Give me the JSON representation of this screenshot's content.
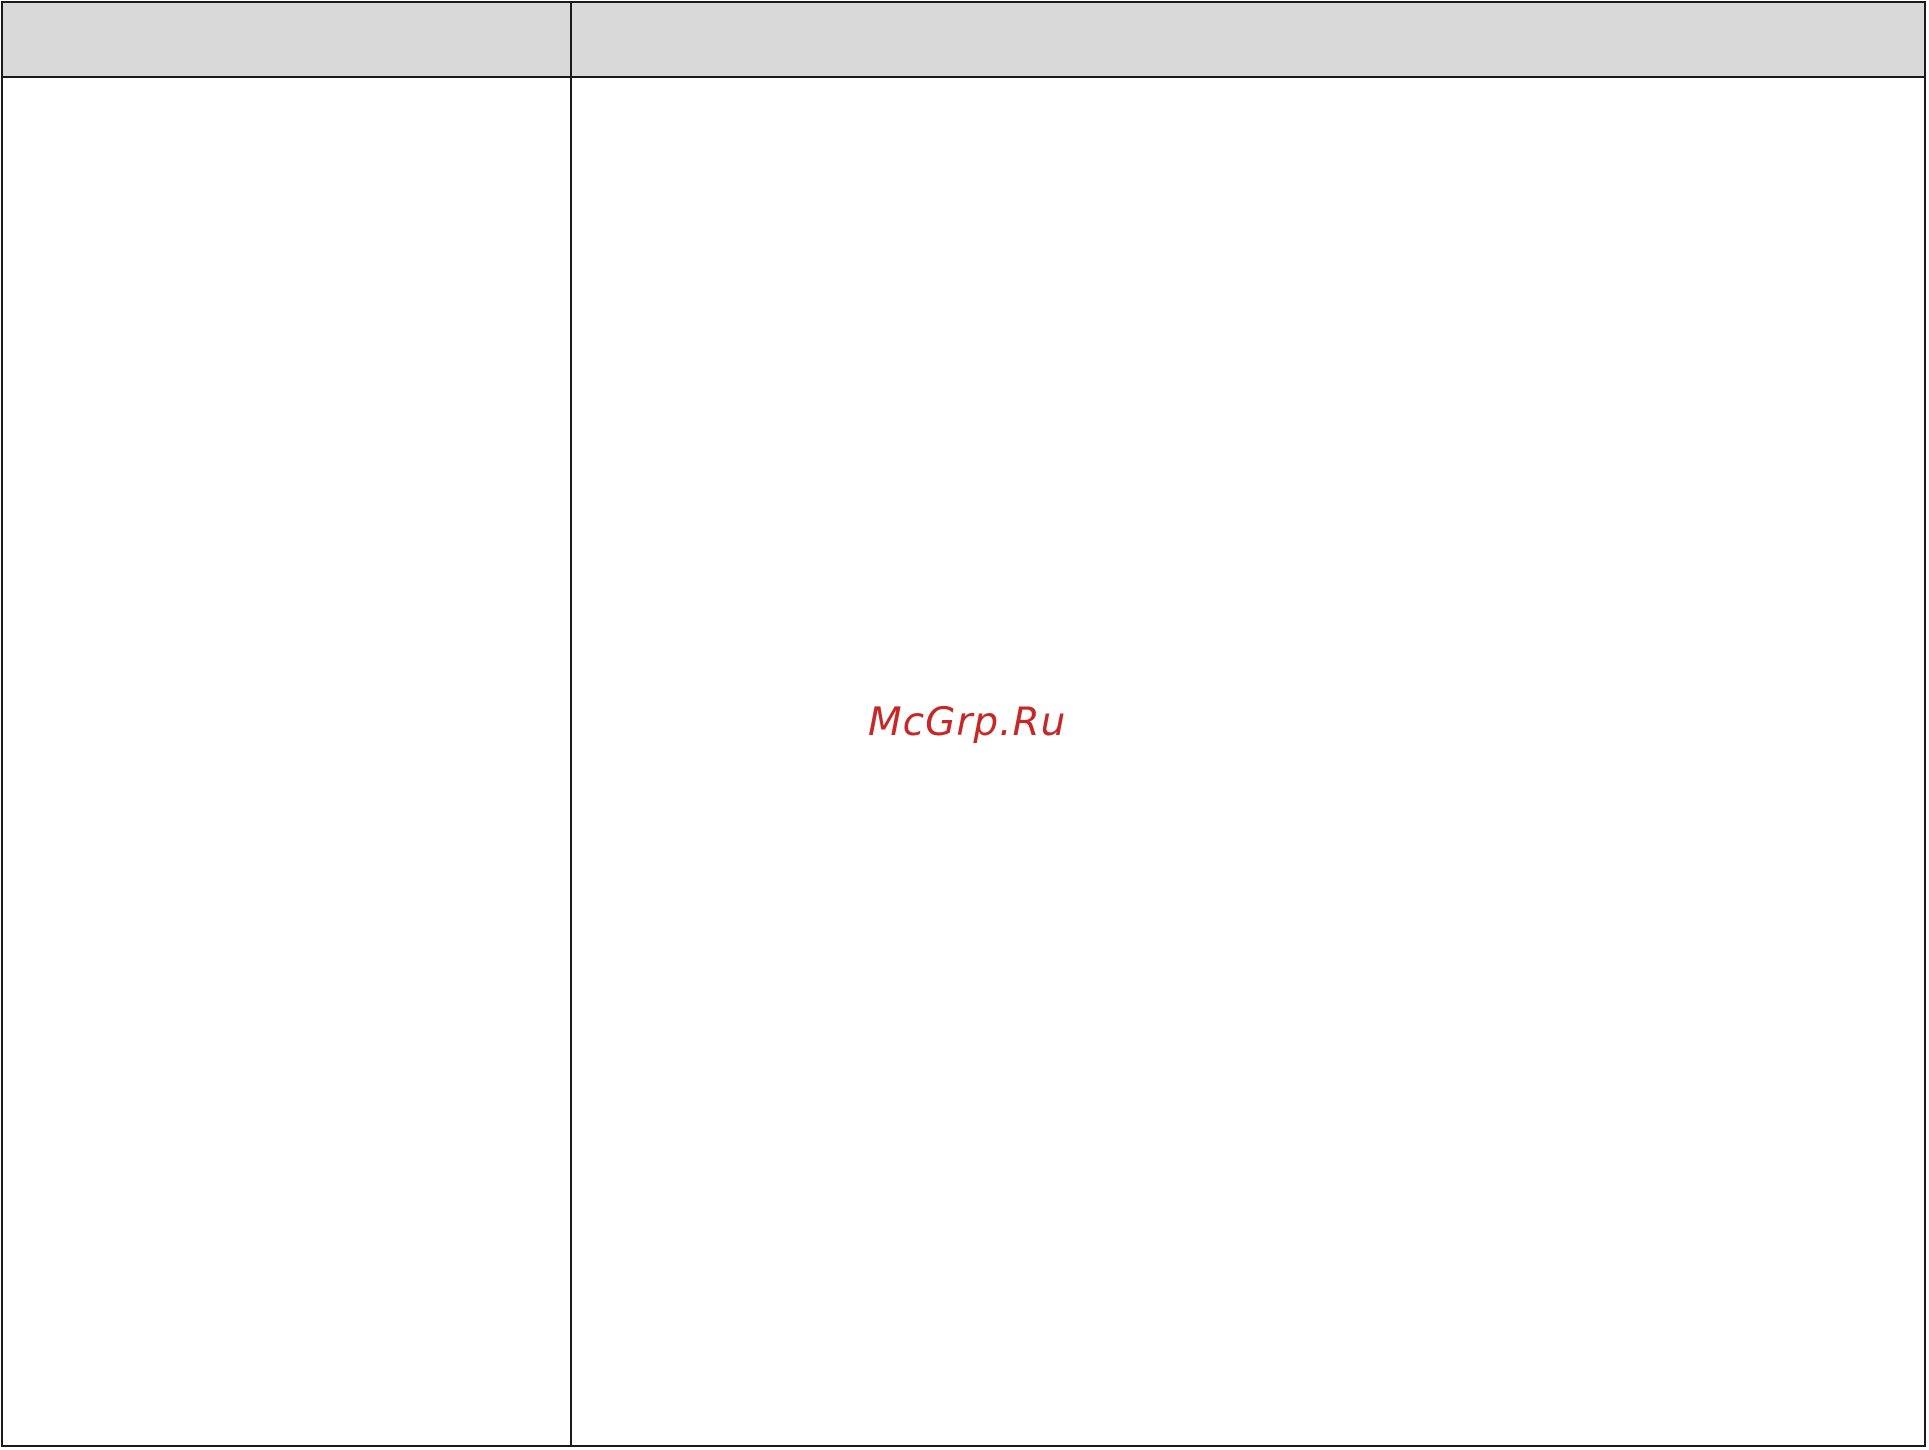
{
  "table": {
    "header": {
      "left": "",
      "right": ""
    },
    "body": {
      "left": "",
      "right": ""
    }
  },
  "watermark": {
    "text": "McGrp.Ru",
    "color": "#c62828"
  },
  "colors": {
    "header_background": "#d9d9d9",
    "border": "#1a1a1a",
    "page_background": "#ffffff"
  }
}
